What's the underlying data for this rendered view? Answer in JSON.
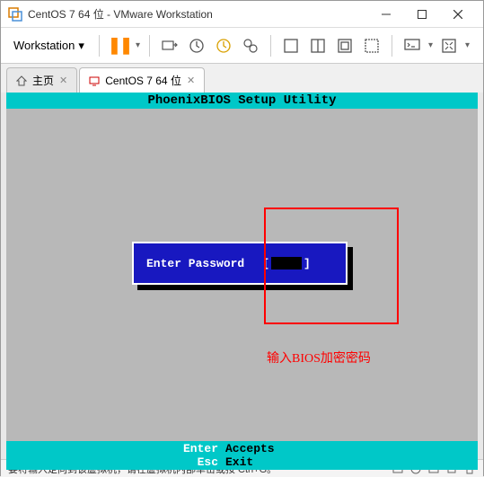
{
  "titlebar": {
    "text": "CentOS 7 64 位 - VMware Workstation"
  },
  "toolbar": {
    "menu_label": "Workstation"
  },
  "tabs": {
    "home": "主页",
    "vm": "CentOS 7 64 位"
  },
  "bios": {
    "header": "PhoenixBIOS Setup Utility",
    "password_label": "Enter Password",
    "annotation": "输入BIOS加密密码",
    "footer": {
      "enter_key": "Enter",
      "enter_action": "Accepts",
      "esc_key": "Esc",
      "esc_action": "Exit"
    }
  },
  "statusbar": {
    "message": "要将输入定向到该虚拟机，请在虚拟机内部单击或按 Ctrl+G。"
  }
}
